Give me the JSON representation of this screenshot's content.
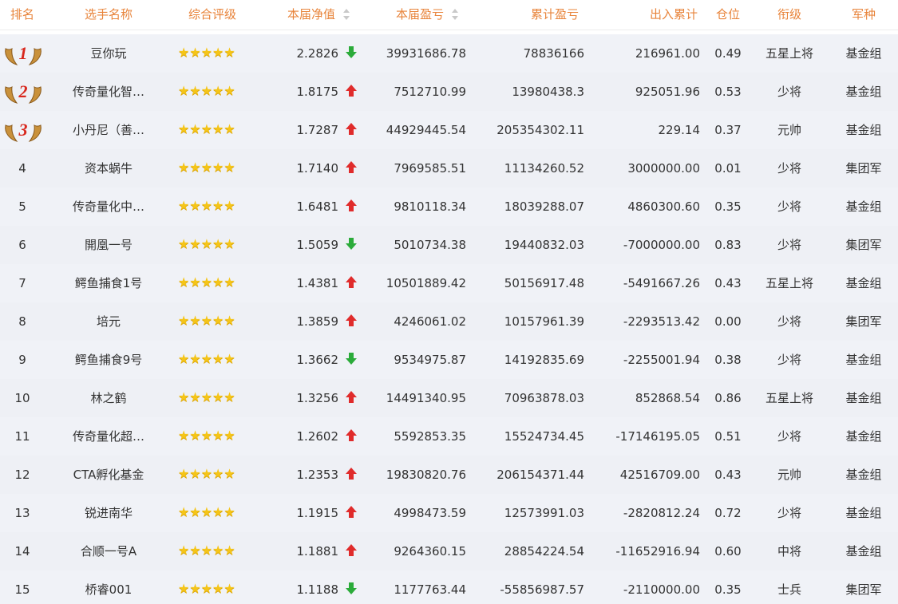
{
  "headers": {
    "rank": "排名",
    "player": "选手名称",
    "rating": "综合评级",
    "nav": "本届净值",
    "pnl": "本届盈亏",
    "cum_pnl": "累计盈亏",
    "flow": "出入累计",
    "position": "仓位",
    "title": "衔级",
    "branch": "军种"
  },
  "colors": {
    "header_text": "#e8843b",
    "up": "#e02b2b",
    "down": "#2bab3a",
    "star": "#f5c518",
    "medal_number": "#d8281e"
  },
  "rows": [
    {
      "rank": "1",
      "medal": true,
      "name": "豆你玩",
      "stars": "★★★★★",
      "nav": "2.2826",
      "trend": "down",
      "pnl": "39931686.78",
      "cum_pnl": "78836166",
      "flow": "216961.00",
      "position": "0.49",
      "title": "五星上将",
      "branch": "基金组"
    },
    {
      "rank": "2",
      "medal": true,
      "name": "传奇量化智…",
      "stars": "★★★★★",
      "nav": "1.8175",
      "trend": "up",
      "pnl": "7512710.99",
      "cum_pnl": "13980438.3",
      "flow": "925051.96",
      "position": "0.53",
      "title": "少将",
      "branch": "基金组"
    },
    {
      "rank": "3",
      "medal": true,
      "name": "小丹尼（善…",
      "stars": "★★★★★",
      "nav": "1.7287",
      "trend": "up",
      "pnl": "44929445.54",
      "cum_pnl": "205354302.11",
      "flow": "229.14",
      "position": "0.37",
      "title": "元帅",
      "branch": "基金组"
    },
    {
      "rank": "4",
      "medal": false,
      "name": "资本蜗牛",
      "stars": "★★★★★",
      "nav": "1.7140",
      "trend": "up",
      "pnl": "7969585.51",
      "cum_pnl": "11134260.52",
      "flow": "3000000.00",
      "position": "0.01",
      "title": "少将",
      "branch": "集团军"
    },
    {
      "rank": "5",
      "medal": false,
      "name": "传奇量化中…",
      "stars": "★★★★★",
      "nav": "1.6481",
      "trend": "up",
      "pnl": "9810118.34",
      "cum_pnl": "18039288.07",
      "flow": "4860300.60",
      "position": "0.35",
      "title": "少将",
      "branch": "基金组"
    },
    {
      "rank": "6",
      "medal": false,
      "name": "開凰一号",
      "stars": "★★★★★",
      "nav": "1.5059",
      "trend": "down",
      "pnl": "5010734.38",
      "cum_pnl": "19440832.03",
      "flow": "-7000000.00",
      "position": "0.83",
      "title": "少将",
      "branch": "集团军"
    },
    {
      "rank": "7",
      "medal": false,
      "name": "鳄鱼捕食1号",
      "stars": "★★★★★",
      "nav": "1.4381",
      "trend": "up",
      "pnl": "10501889.42",
      "cum_pnl": "50156917.48",
      "flow": "-5491667.26",
      "position": "0.43",
      "title": "五星上将",
      "branch": "基金组"
    },
    {
      "rank": "8",
      "medal": false,
      "name": "培元",
      "stars": "★★★★★",
      "nav": "1.3859",
      "trend": "up",
      "pnl": "4246061.02",
      "cum_pnl": "10157961.39",
      "flow": "-2293513.42",
      "position": "0.00",
      "title": "少将",
      "branch": "集团军"
    },
    {
      "rank": "9",
      "medal": false,
      "name": "鳄鱼捕食9号",
      "stars": "★★★★★",
      "nav": "1.3662",
      "trend": "down",
      "pnl": "9534975.87",
      "cum_pnl": "14192835.69",
      "flow": "-2255001.94",
      "position": "0.38",
      "title": "少将",
      "branch": "基金组"
    },
    {
      "rank": "10",
      "medal": false,
      "name": "林之鹤",
      "stars": "★★★★★",
      "nav": "1.3256",
      "trend": "up",
      "pnl": "14491340.95",
      "cum_pnl": "70963878.03",
      "flow": "852868.54",
      "position": "0.86",
      "title": "五星上将",
      "branch": "基金组"
    },
    {
      "rank": "11",
      "medal": false,
      "name": "传奇量化超…",
      "stars": "★★★★★",
      "nav": "1.2602",
      "trend": "up",
      "pnl": "5592853.35",
      "cum_pnl": "15524734.45",
      "flow": "-17146195.05",
      "position": "0.51",
      "title": "少将",
      "branch": "基金组"
    },
    {
      "rank": "12",
      "medal": false,
      "name": "CTA孵化基金",
      "stars": "★★★★★",
      "nav": "1.2353",
      "trend": "up",
      "pnl": "19830820.76",
      "cum_pnl": "206154371.44",
      "flow": "42516709.00",
      "position": "0.43",
      "title": "元帅",
      "branch": "基金组"
    },
    {
      "rank": "13",
      "medal": false,
      "name": "锐进南华",
      "stars": "★★★★★",
      "nav": "1.1915",
      "trend": "up",
      "pnl": "4998473.59",
      "cum_pnl": "12573991.03",
      "flow": "-2820812.24",
      "position": "0.72",
      "title": "少将",
      "branch": "基金组"
    },
    {
      "rank": "14",
      "medal": false,
      "name": "合顺一号A",
      "stars": "★★★★★",
      "nav": "1.1881",
      "trend": "up",
      "pnl": "9264360.15",
      "cum_pnl": "28854224.54",
      "flow": "-11652916.94",
      "position": "0.60",
      "title": "中将",
      "branch": "基金组"
    },
    {
      "rank": "15",
      "medal": false,
      "name": "桥睿001",
      "stars": "★★★★★",
      "nav": "1.1188",
      "trend": "down",
      "pnl": "1177763.44",
      "cum_pnl": "-55856987.57",
      "flow": "-2110000.00",
      "position": "0.35",
      "title": "士兵",
      "branch": "集团军"
    }
  ]
}
